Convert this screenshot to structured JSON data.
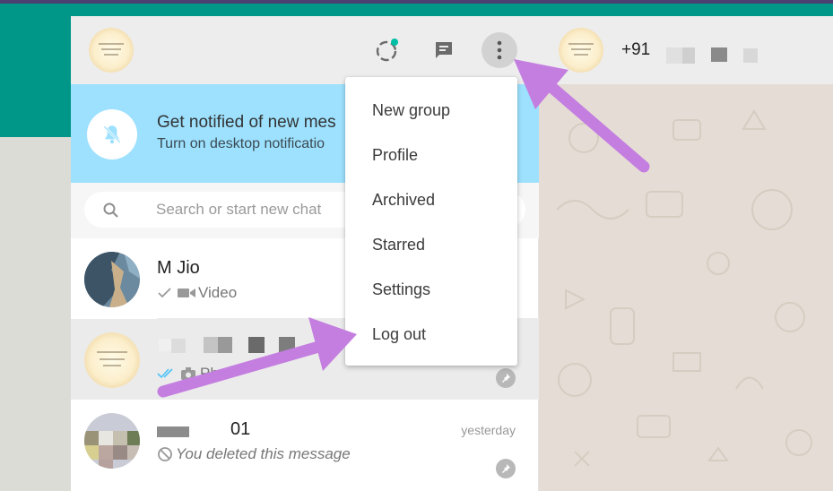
{
  "header": {
    "status_icon": "status-ring-icon",
    "new_chat_icon": "chat-icon",
    "menu_icon": "kebab-menu-icon"
  },
  "notification": {
    "title": "Get notified of new mes",
    "subtitle": "Turn on desktop notificatio",
    "icon": "bell-off-icon"
  },
  "search": {
    "placeholder": "Search or start new chat"
  },
  "chats": [
    {
      "name": "M Jio",
      "preview": "Video",
      "status": "sent-check"
    },
    {
      "name": "",
      "preview": "Phot",
      "status": "read-double-check"
    },
    {
      "name": "01",
      "preview": "You deleted this message",
      "time": "yesterday"
    }
  ],
  "conversation": {
    "phone": "+91"
  },
  "menu": {
    "items": [
      "New group",
      "Profile",
      "Archived",
      "Starred",
      "Settings",
      "Log out"
    ]
  },
  "colors": {
    "teal": "#009688",
    "banner": "#9de1fe",
    "arrow": "#c47ee0",
    "read_tick": "#4fc3f7"
  }
}
